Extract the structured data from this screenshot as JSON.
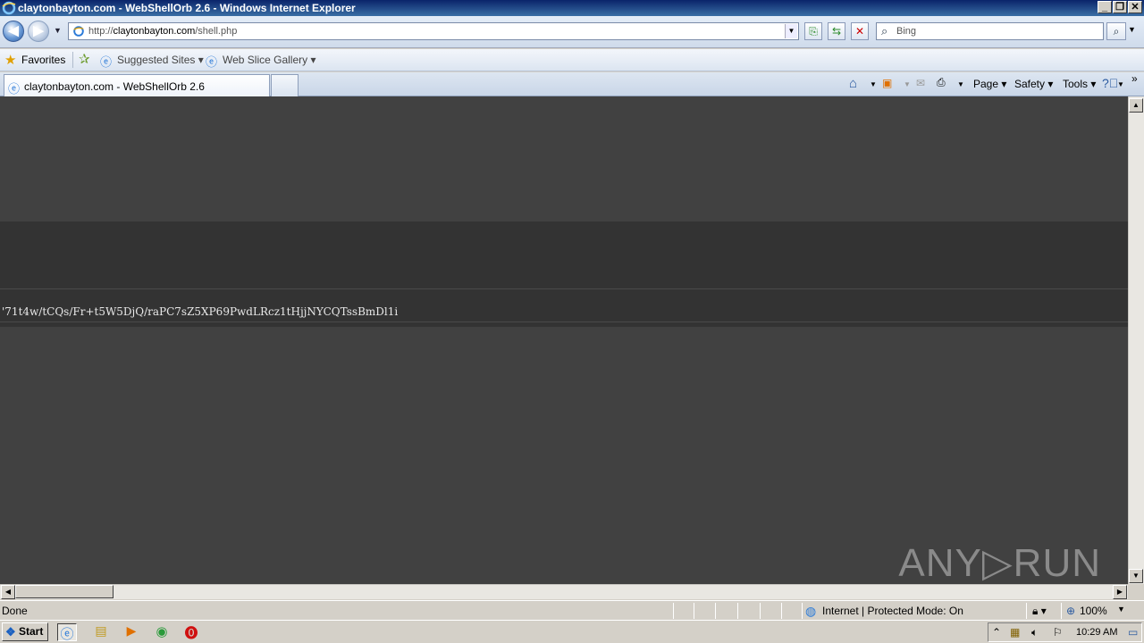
{
  "window": {
    "title": "claytonbayton.com - WebShellOrb 2.6 - Windows Internet Explorer",
    "controls": [
      "_",
      "❐",
      "✕"
    ]
  },
  "address": {
    "url_prefix": "http://",
    "url_domain": "claytonbayton.com",
    "url_path": "/shell.php",
    "search_placeholder": "Bing"
  },
  "favorites": {
    "favorites_label": "Favorites",
    "suggested_sites": "Suggested Sites",
    "web_slice_gallery": "Web Slice Gallery"
  },
  "tabs": [
    {
      "label": "claytonbayton.com - WebShellOrb 2.6"
    }
  ],
  "commandbar": {
    "page": "Page",
    "safety": "Safety",
    "tools": "Tools"
  },
  "content": {
    "shell_text": "'71t4w/tCQs/Fr+t5W5DjQ/raPC7sZ5XP69PwdLRcz1tHjjNYCQTssBmDl1i",
    "watermark": "ANY▷RUN"
  },
  "status": {
    "text": "Done",
    "zone": "Internet | Protected Mode: On",
    "zoom": "100%"
  },
  "taskbar": {
    "start_label": "Start",
    "clock": "10:29 AM"
  },
  "colors": {
    "content_bg": "#414141",
    "band_bg": "#333333",
    "titlebar": "#0a246a"
  }
}
